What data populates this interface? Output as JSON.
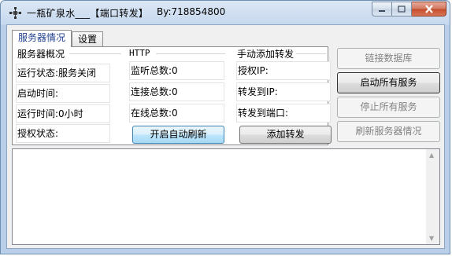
{
  "window": {
    "title": "一瓶矿泉水___【端口转发】",
    "author": "By:718854800",
    "icons": {
      "app": "network-nodes-icon",
      "minimize": "minimize-icon",
      "maximize": "maximize-icon",
      "close": "close-icon"
    }
  },
  "tabs": [
    {
      "label": "服务器情况",
      "active": true
    },
    {
      "label": "设置",
      "active": false
    }
  ],
  "overview": {
    "title": "服务器概况",
    "status": "运行状态:服务关闭",
    "start_time": "启动时间:",
    "run_time": "运行时间:0小时",
    "auth_status": "授权状态:"
  },
  "http": {
    "title": "HTTP",
    "listen_total": "监听总数:0",
    "connect_total": "连接总数:0",
    "online_total": "在线总数:0",
    "auto_refresh_button": "开启自动刷新"
  },
  "manual_forward": {
    "title": "手动添加转发",
    "auth_ip": "授权IP:",
    "forward_ip": "转发到IP:",
    "forward_port": "转发到端口:",
    "add_button": "添加转发"
  },
  "actions": {
    "connect_db": "链接数据库",
    "start_all": "启动所有服务",
    "stop_all": "停止所有服务",
    "refresh_info": "刷新服务器情况"
  },
  "colors": {
    "accent": "#3c7fb1",
    "disabled_text": "#838383"
  }
}
